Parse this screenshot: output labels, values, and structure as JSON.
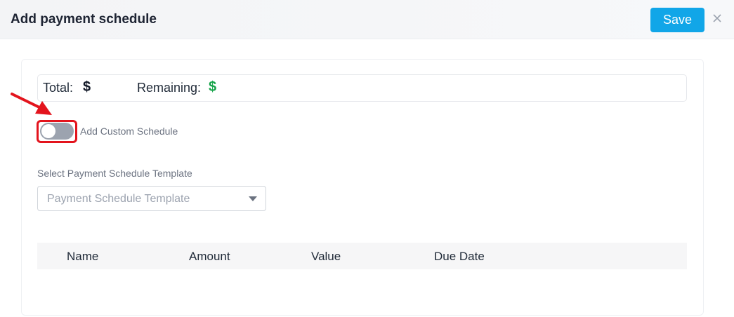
{
  "modal": {
    "title": "Add payment schedule",
    "save_label": "Save",
    "close_icon": "close-icon"
  },
  "totals": {
    "total_label": "Total:",
    "total_currency": "$",
    "remaining_label": "Remaining:",
    "remaining_currency": "$",
    "remaining_color": "#16a34a"
  },
  "custom_schedule": {
    "label": "Add Custom Schedule",
    "enabled": false,
    "highlight_color": "#e3141d"
  },
  "template_select": {
    "label": "Select Payment Schedule Template",
    "placeholder": "Payment Schedule Template"
  },
  "schedule_table": {
    "columns": [
      "Name",
      "Amount",
      "Value",
      "Due Date"
    ]
  },
  "colors": {
    "accent": "#11a6e8",
    "annotation_red": "#e3141d"
  }
}
